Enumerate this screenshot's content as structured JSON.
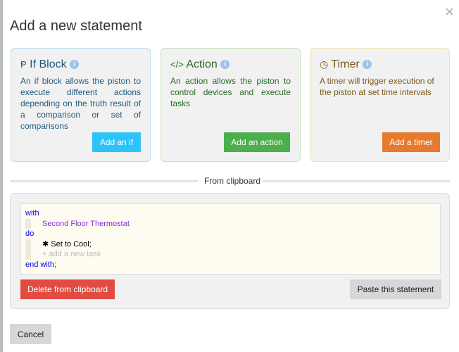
{
  "dialog": {
    "title": "Add a new statement",
    "close_icon": "×"
  },
  "cards": [
    {
      "title": "If Block",
      "icon": "branch-icon",
      "glyph": "Ᵽ",
      "description": "An if block allows the piston to execute different actions depending on the truth result of a comparison or set of comparisons",
      "button": "Add an if",
      "color": "#2dc3f8",
      "text_color": "#1f5a7c",
      "border": "#b9dcf0"
    },
    {
      "title": "Action",
      "icon": "code-icon",
      "glyph": "</>",
      "description": "An action allows the piston to control devices and execute tasks",
      "button": "Add an action",
      "color": "#4cae4c",
      "text_color": "#2a6a26",
      "border": "#c7e3bc"
    },
    {
      "title": "Timer",
      "icon": "clock-icon",
      "glyph": "◷",
      "description": "A timer will trigger execution of the piston at set time intervals",
      "button": "Add a timer",
      "color": "#e77a2d",
      "text_color": "#7a5a1c",
      "border": "#f3e4ad"
    }
  ],
  "clipboard": {
    "heading": "From clipboard",
    "code": {
      "with": "with",
      "device": "Second Floor Thermostat",
      "do": "do",
      "task_icon": "✱",
      "task": "Set to Cool;",
      "add_task": "+ add a new task",
      "end": "end with;"
    },
    "delete_label": "Delete from clipboard",
    "paste_label": "Paste this statement"
  },
  "footer": {
    "cancel_label": "Cancel"
  }
}
